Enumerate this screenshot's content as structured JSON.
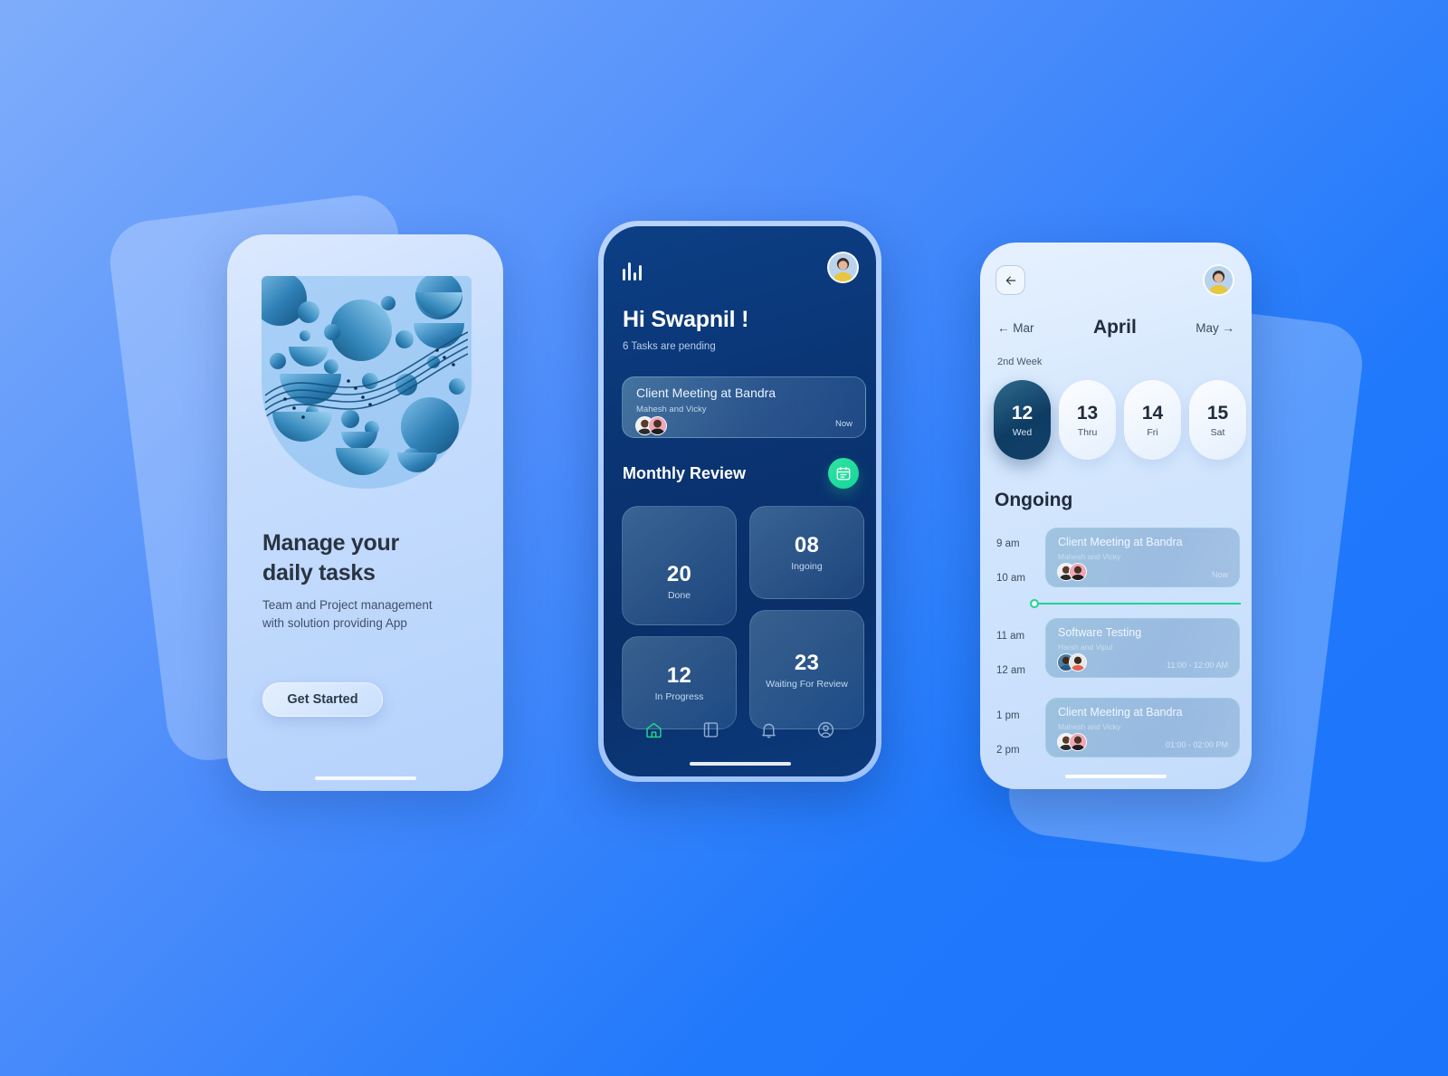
{
  "theme": {
    "bg_from": "#7FADFB",
    "bg_to": "#1C74FB",
    "accent_green": "#1FD48F",
    "dark_blue": "#0A3473"
  },
  "onboarding": {
    "illustration": "abstract-spheres-illustration",
    "title_line1": "Manage your",
    "title_line2": "daily tasks",
    "subtitle_line1": "Team and Project management",
    "subtitle_line2": "with solution providing App",
    "cta_label": "Get Started"
  },
  "home": {
    "logo": "bars-logo",
    "avatar": "user-avatar",
    "greeting": "Hi Swapnil !",
    "pending": "6 Tasks are pending",
    "featured_task": {
      "title": "Client Meeting at Bandra",
      "people": "Mahesh and Vicky",
      "when": "Now"
    },
    "section_title": "Monthly Review",
    "calendar_button": "calendar-icon",
    "stats": [
      {
        "value": "20",
        "label": "Done"
      },
      {
        "value": "08",
        "label": "Ingoing"
      },
      {
        "value": "12",
        "label": "In Progress"
      },
      {
        "value": "23",
        "label": "Waiting For Review"
      }
    ],
    "nav": [
      {
        "icon": "home-icon",
        "active": true
      },
      {
        "icon": "book-icon",
        "active": false
      },
      {
        "icon": "bell-icon",
        "active": false
      },
      {
        "icon": "profile-icon",
        "active": false
      }
    ]
  },
  "schedule": {
    "back_icon": "arrow-left-icon",
    "avatar": "user-avatar",
    "prev_month": "Mar",
    "current_month": "April",
    "next_month": "May",
    "week_label": "2nd Week",
    "dates": [
      {
        "day": "12",
        "weekday": "Wed",
        "selected": true
      },
      {
        "day": "13",
        "weekday": "Thru",
        "selected": false
      },
      {
        "day": "14",
        "weekday": "Fri",
        "selected": false
      },
      {
        "day": "15",
        "weekday": "Sat",
        "selected": false
      }
    ],
    "list_title": "Ongoing",
    "hours": [
      "9 am",
      "10 am",
      "11 am",
      "12 am",
      "1 pm",
      "2 pm"
    ],
    "events": [
      {
        "title": "Client Meeting at Bandra",
        "people": "Mahesh and Vicky",
        "time": "Now"
      },
      {
        "title": "Software Testing",
        "people": "Harsh and Vipul",
        "time": "11:00 - 12:00 AM"
      },
      {
        "title": "Client Meeting at Bandra",
        "people": "Mahesh and Vicky",
        "time": "01:00 - 02:00 PM"
      }
    ]
  }
}
